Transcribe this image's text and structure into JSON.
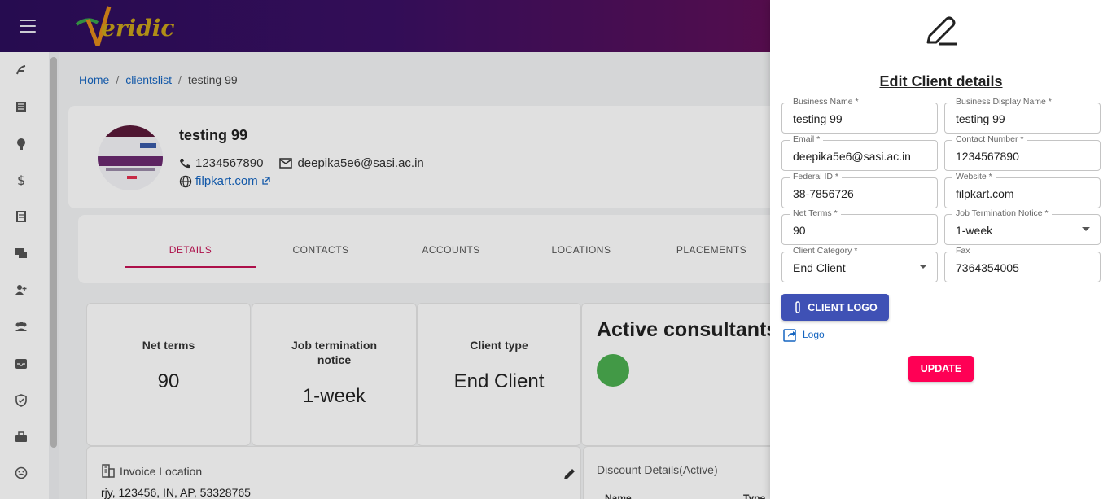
{
  "breadcrumb": {
    "home": "Home",
    "clientslist": "clientslist",
    "current": "testing 99"
  },
  "profile": {
    "name": "testing 99",
    "phone": "1234567890",
    "email": "deepika5e6@sasi.ac.in",
    "website": "filpkart.com"
  },
  "tabs": [
    "DETAILS",
    "CONTACTS",
    "ACCOUNTS",
    "LOCATIONS",
    "PLACEMENTS"
  ],
  "stats": {
    "net_terms": {
      "label": "Net terms",
      "value": "90"
    },
    "job_termination": {
      "label_line1": "Job termination",
      "label_line2": "notice",
      "value": "1-week"
    },
    "client_type": {
      "label": "Client type",
      "value": "End Client"
    },
    "active_consultants": {
      "label": "Active consultants ("
    }
  },
  "invoice": {
    "label": "Invoice Location",
    "address": "rjy, 123456, IN, AP, 53328765"
  },
  "discount": {
    "title": "Discount Details(Active)",
    "col_name": "Name",
    "col_type": "Type"
  },
  "drawer": {
    "title": "Edit Client details",
    "fields": {
      "business_name": {
        "label": "Business Name *",
        "value": "testing 99"
      },
      "business_display_name": {
        "label": "Business Display Name *",
        "value": "testing 99"
      },
      "email": {
        "label": "Email *",
        "value": "deepika5e6@sasi.ac.in"
      },
      "contact_number": {
        "label": "Contact Number *",
        "value": "1234567890"
      },
      "federal_id": {
        "label": "Federal ID *",
        "value": "38-7856726"
      },
      "website": {
        "label": "Website *",
        "value": "filpkart.com"
      },
      "net_terms": {
        "label": "Net Terms *",
        "value": "90"
      },
      "job_termination_notice": {
        "label": "Job Termination Notice *",
        "value": "1-week"
      },
      "client_category": {
        "label": "Client Category *",
        "value": "End Client"
      },
      "fax": {
        "label": "Fax",
        "value": "7364354005"
      }
    },
    "client_logo_button": "CLIENT LOGO",
    "logo_link": "Logo",
    "update_button": "UPDATE"
  },
  "colors": {
    "accent": "#c51355",
    "update": "#ff0055",
    "primary_button": "#3f51b5",
    "link": "#1565c0"
  }
}
